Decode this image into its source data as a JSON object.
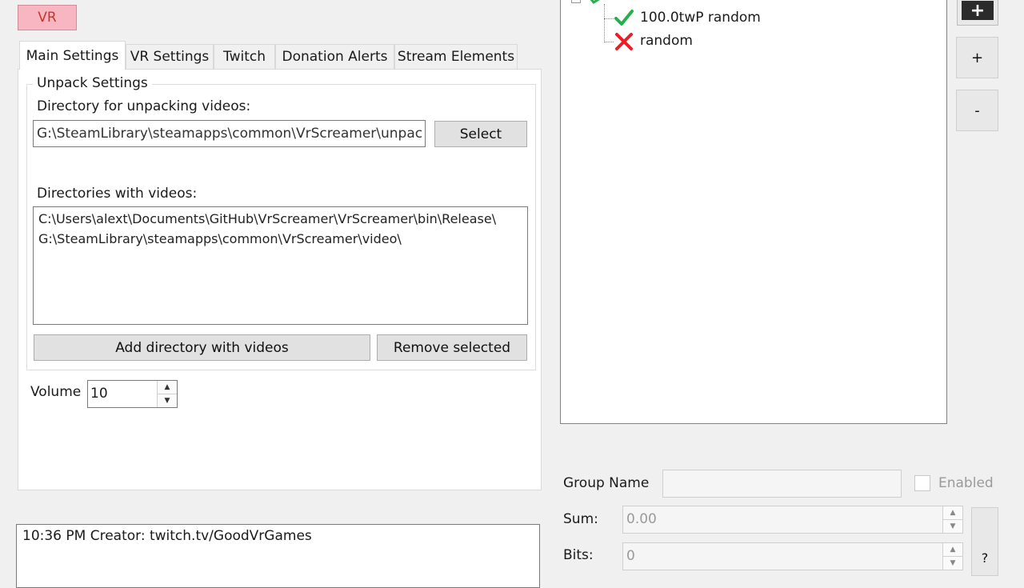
{
  "top_button": {
    "label": "VR"
  },
  "tabs": [
    {
      "label": "Main Settings",
      "active": true
    },
    {
      "label": "VR Settings"
    },
    {
      "label": "Twitch"
    },
    {
      "label": "Donation Alerts"
    },
    {
      "label": "Stream Elements"
    }
  ],
  "unpack": {
    "group_title": "Unpack Settings",
    "dir_label": "Directory for unpacking videos:",
    "dir_value": "G:\\SteamLibrary\\steamapps\\common\\VrScreamer\\unpac",
    "select_label": "Select",
    "dirs_label": "Directories with videos:",
    "dirs": [
      "C:\\Users\\alext\\Documents\\GitHub\\VrScreamer\\VrScreamer\\bin\\Release\\",
      "G:\\SteamLibrary\\steamapps\\common\\VrScreamer\\video\\"
    ],
    "add_label": "Add directory with videos",
    "remove_label": "Remove selected"
  },
  "volume": {
    "label": "Volume",
    "value": "10"
  },
  "log": {
    "text": "10:36 PM Creator: twitch.tv/GoodVrGames"
  },
  "tree": {
    "items": [
      {
        "label": "100.0twP random",
        "status": "ok"
      },
      {
        "label": "random",
        "status": "error"
      }
    ]
  },
  "side_buttons": {
    "top": "+",
    "plus": "+",
    "minus": "-",
    "help": "?"
  },
  "group": {
    "name_label": "Group Name",
    "enabled_label": "Enabled",
    "sum_label": "Sum:",
    "sum_value": "0.00",
    "bits_label": "Bits:",
    "bits_value": "0"
  },
  "colors": {
    "ok": "#22b14c",
    "error": "#ee1c25",
    "vr_button_bg": "#f8b6c2"
  }
}
